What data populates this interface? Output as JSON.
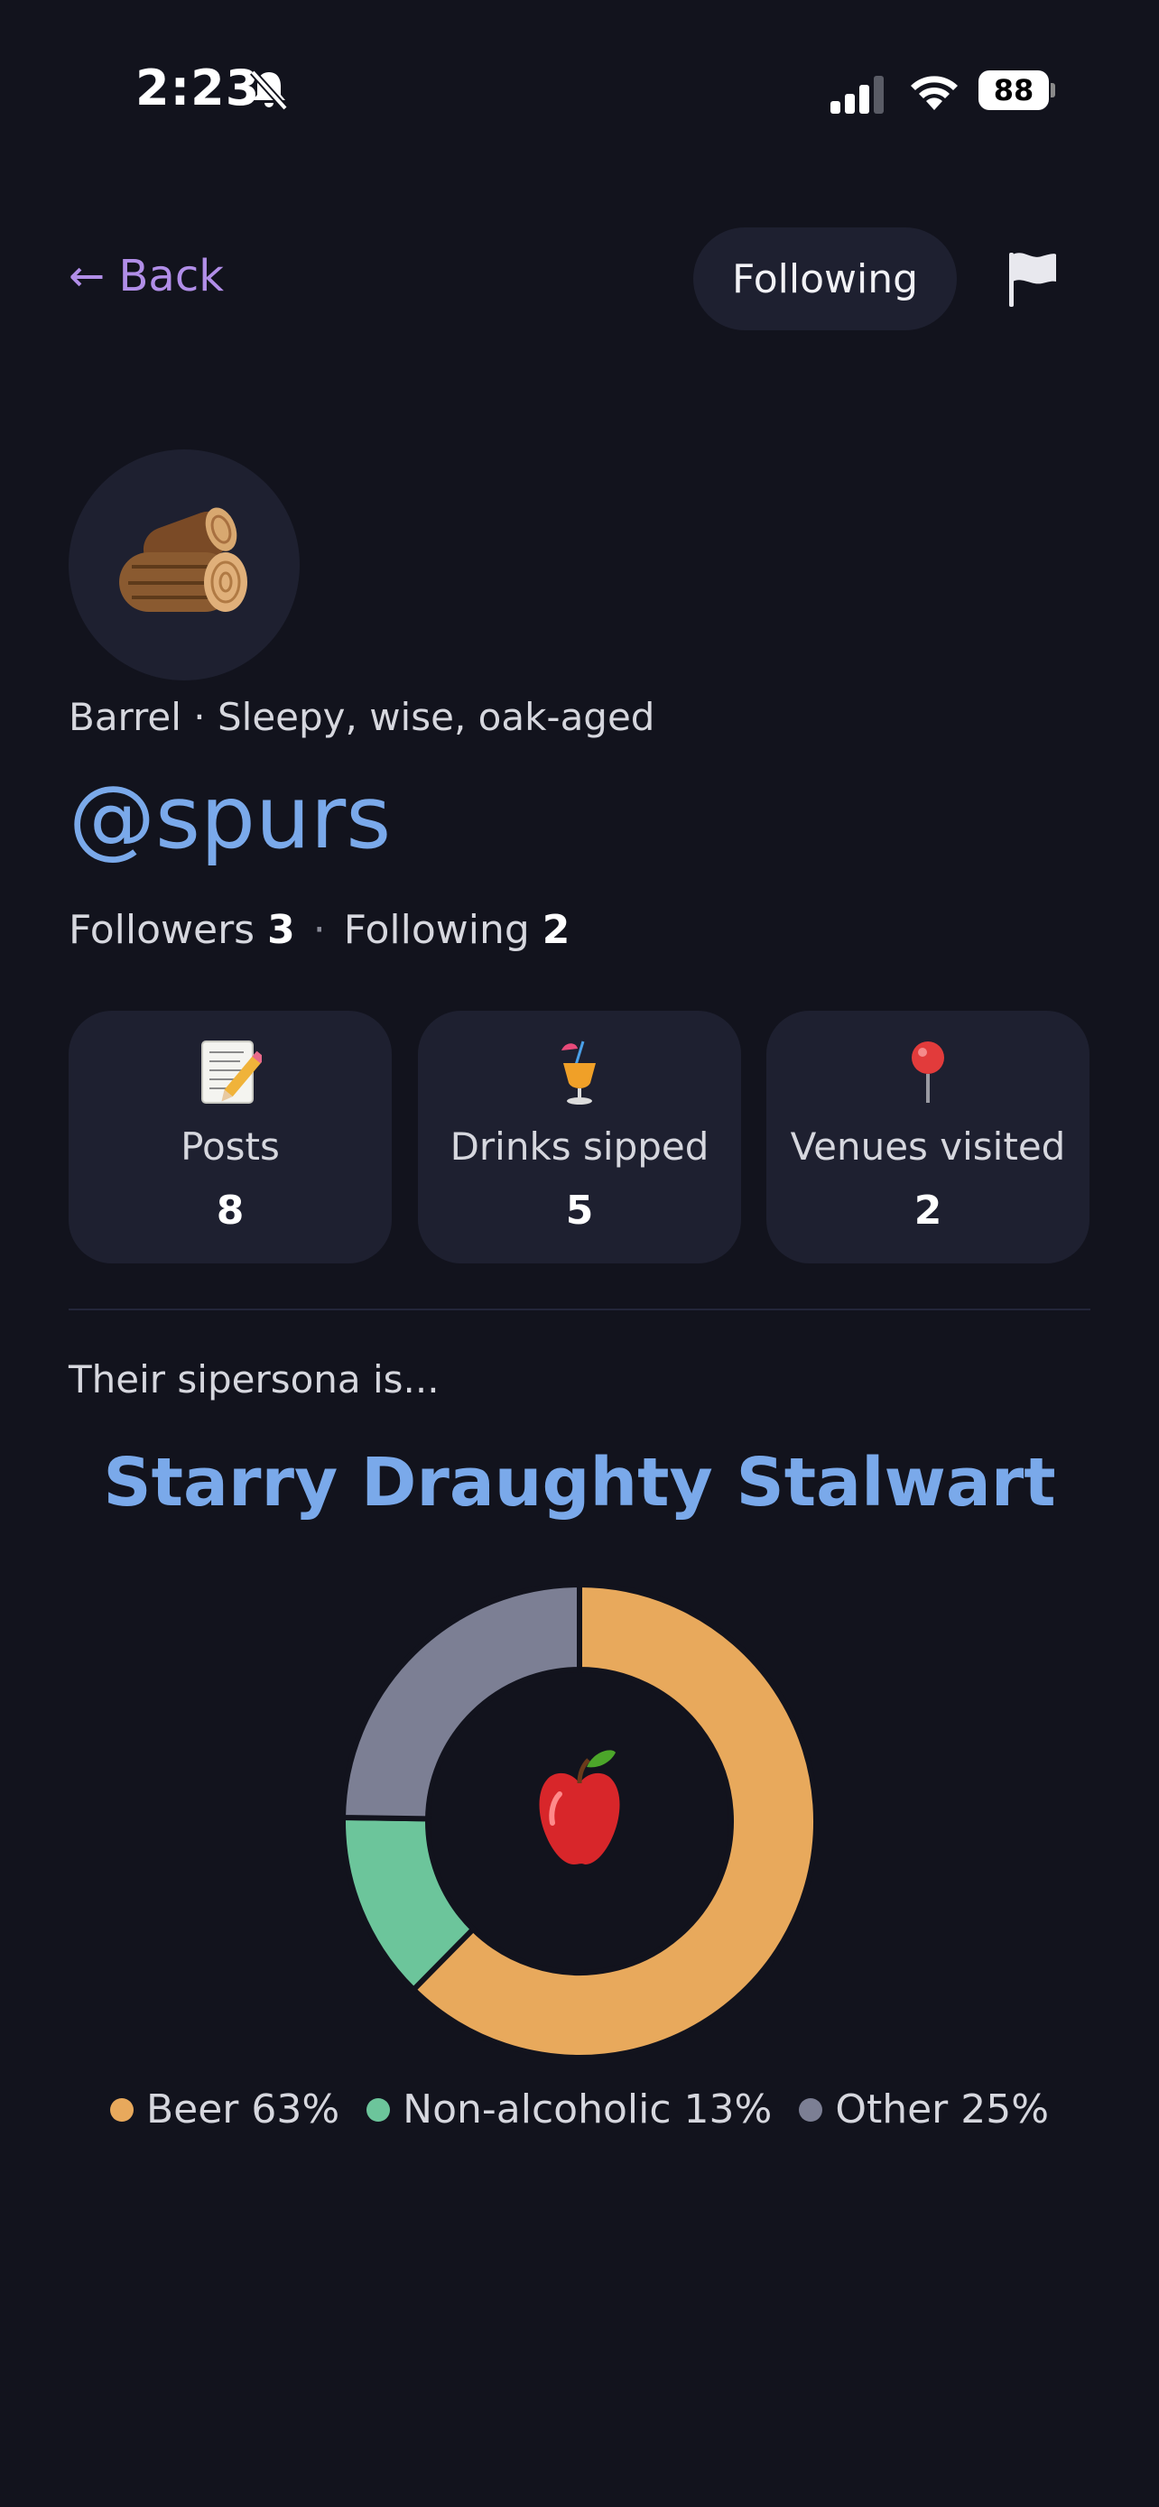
{
  "status_bar": {
    "time": "2:23",
    "battery": "88"
  },
  "nav": {
    "back_label": "← Back",
    "follow_button": "Following"
  },
  "profile": {
    "persona_line": "Barrel · Sleepy, wise, oak-aged",
    "handle": "@spurs",
    "followers_label": "Followers",
    "followers_count": "3",
    "following_label": "Following",
    "following_count": "2"
  },
  "stats": [
    {
      "icon": "memo-icon",
      "label": "Posts",
      "value": "8"
    },
    {
      "icon": "tropical-drink-icon",
      "label": "Drinks sipped",
      "value": "5"
    },
    {
      "icon": "pushpin-icon",
      "label": "Venues visited",
      "value": "2"
    }
  ],
  "sipersona": {
    "intro": "Their sipersona is...",
    "title": "Starry Draughty Stalwart",
    "center_icon": "apple-icon"
  },
  "chart_data": {
    "type": "pie",
    "donut": true,
    "categories": [
      "Beer",
      "Non-alcoholic",
      "Other"
    ],
    "values": [
      63,
      13,
      25
    ],
    "colors": [
      "#e8a95c",
      "#6cc59b",
      "#7c7f94"
    ],
    "legend": [
      "Beer 63%",
      "Non-alcoholic 13%",
      "Other 25%"
    ],
    "legend_position": "bottom"
  }
}
